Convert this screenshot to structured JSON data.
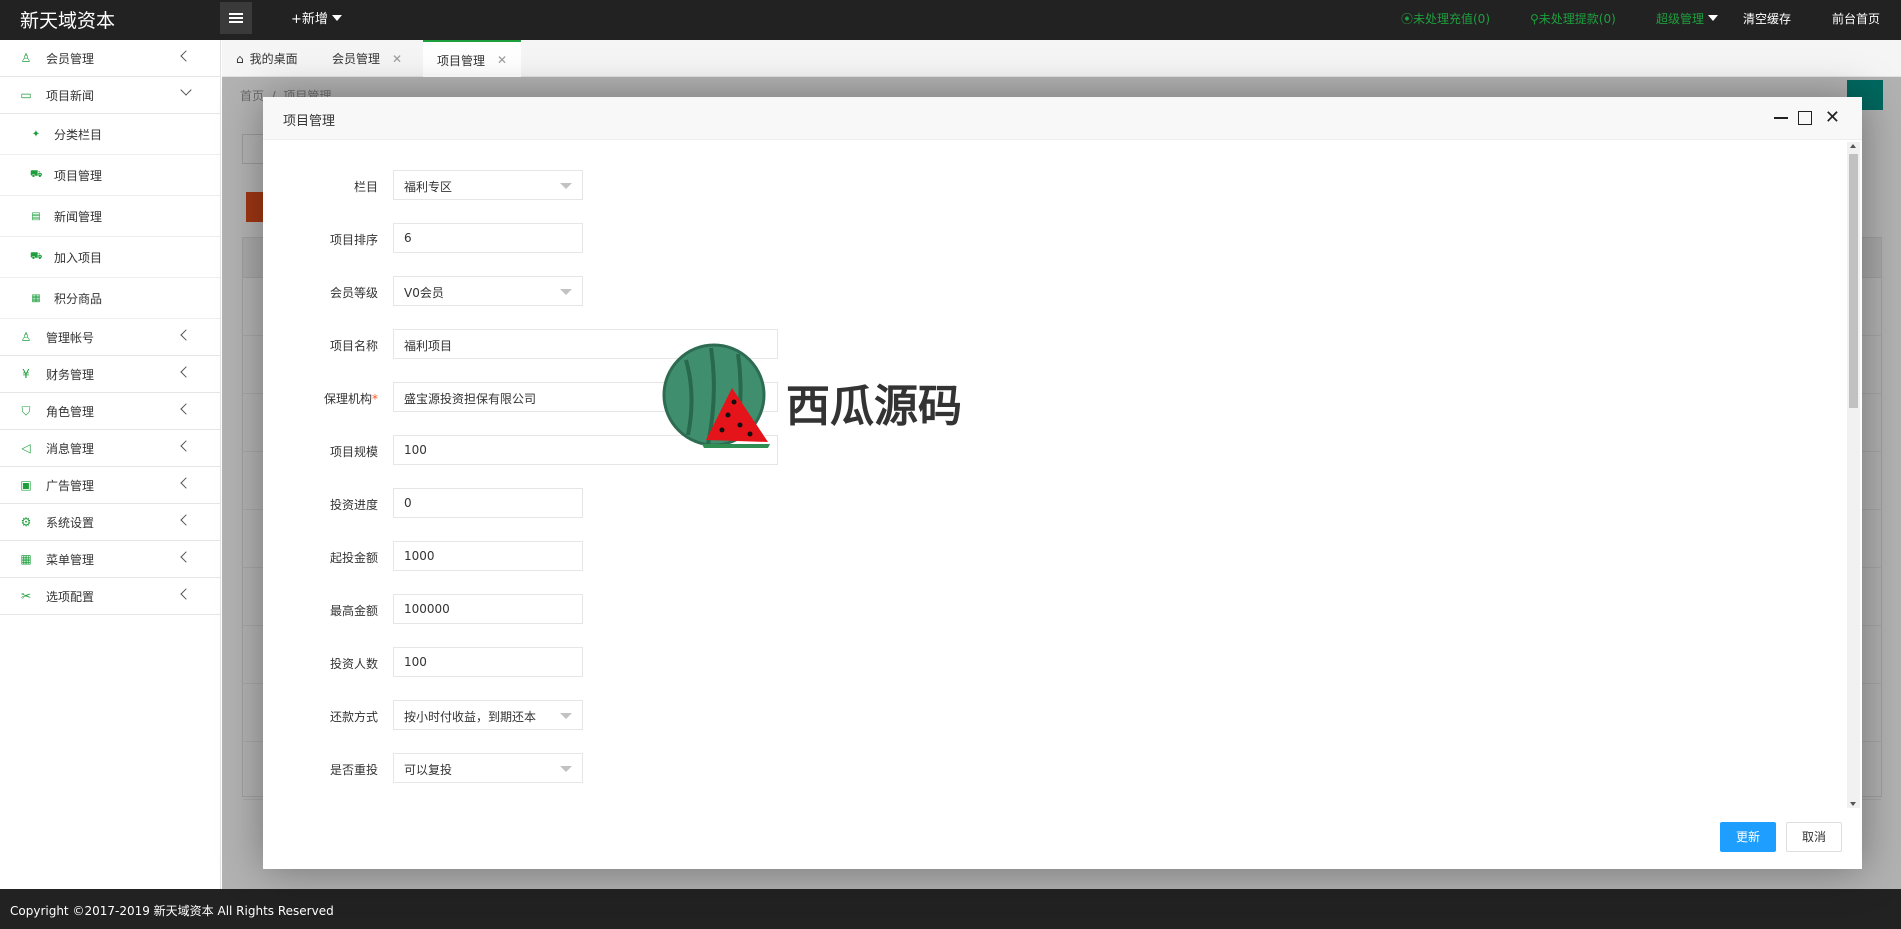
{
  "header": {
    "logo": "新天域资本",
    "add_new": "+新增",
    "recharge": "⦿未处理充值(0)",
    "withdraw": "⚲未处理提款(0)",
    "admin": "超级管理",
    "clear_cache": "清空缓存",
    "frontend": "前台首页"
  },
  "sidebar": {
    "items": [
      {
        "label": "会员管理",
        "icon": "user-icon"
      },
      {
        "label": "项目新闻",
        "icon": "book-icon"
      }
    ],
    "sub_items": [
      {
        "label": "分类栏目",
        "icon": "leaf-icon"
      },
      {
        "label": "项目管理",
        "icon": "cart-icon"
      },
      {
        "label": "新闻管理",
        "icon": "doc-icon"
      },
      {
        "label": "加入项目",
        "icon": "cart-icon"
      },
      {
        "label": "积分商品",
        "icon": "grid-icon"
      }
    ],
    "items_after": [
      {
        "label": "管理帐号",
        "icon": "users-icon"
      },
      {
        "label": "财务管理",
        "icon": "yen-icon"
      },
      {
        "label": "角色管理",
        "icon": "shield-icon"
      },
      {
        "label": "消息管理",
        "icon": "speaker-icon"
      },
      {
        "label": "广告管理",
        "icon": "image-icon"
      },
      {
        "label": "系统设置",
        "icon": "gear-icon"
      },
      {
        "label": "菜单管理",
        "icon": "menu-icon"
      },
      {
        "label": "选项配置",
        "icon": "tools-icon"
      }
    ]
  },
  "tabs": {
    "home": "我的桌面",
    "members": "会员管理",
    "projects": "项目管理"
  },
  "main": {
    "breadcrumb_home": "首页",
    "breadcrumb_sep": "/",
    "breadcrumb_current": "项目管理"
  },
  "modal": {
    "title": "项目管理",
    "fields": {
      "column": {
        "label": "栏目",
        "value": "福利专区"
      },
      "sort": {
        "label": "项目排序",
        "value": "6"
      },
      "level": {
        "label": "会员等级",
        "value": "V0会员"
      },
      "name": {
        "label": "项目名称",
        "value": "福利项目"
      },
      "guarantor": {
        "label": "保理机构",
        "required": "*",
        "value": "盛宝源投资担保有限公司"
      },
      "scale": {
        "label": "项目规模",
        "value": "100"
      },
      "progress": {
        "label": "投资进度",
        "value": "0"
      },
      "min_amount": {
        "label": "起投金额",
        "value": "1000"
      },
      "max_amount": {
        "label": "最高金额",
        "value": "100000"
      },
      "investors": {
        "label": "投资人数",
        "value": "100"
      },
      "repayment": {
        "label": "还款方式",
        "value": "按小时付收益，到期还本"
      },
      "reinvest": {
        "label": "是否重投",
        "value": "可以复投"
      }
    },
    "update_btn": "更新",
    "cancel_btn": "取消"
  },
  "watermark": "西瓜源码",
  "footer": "Copyright ©2017-2019 新天域资本 All Rights Reserved",
  "colors": {
    "accent": "#1e9f3e",
    "primary_btn": "#1e9fff",
    "header_bg": "#222222"
  }
}
